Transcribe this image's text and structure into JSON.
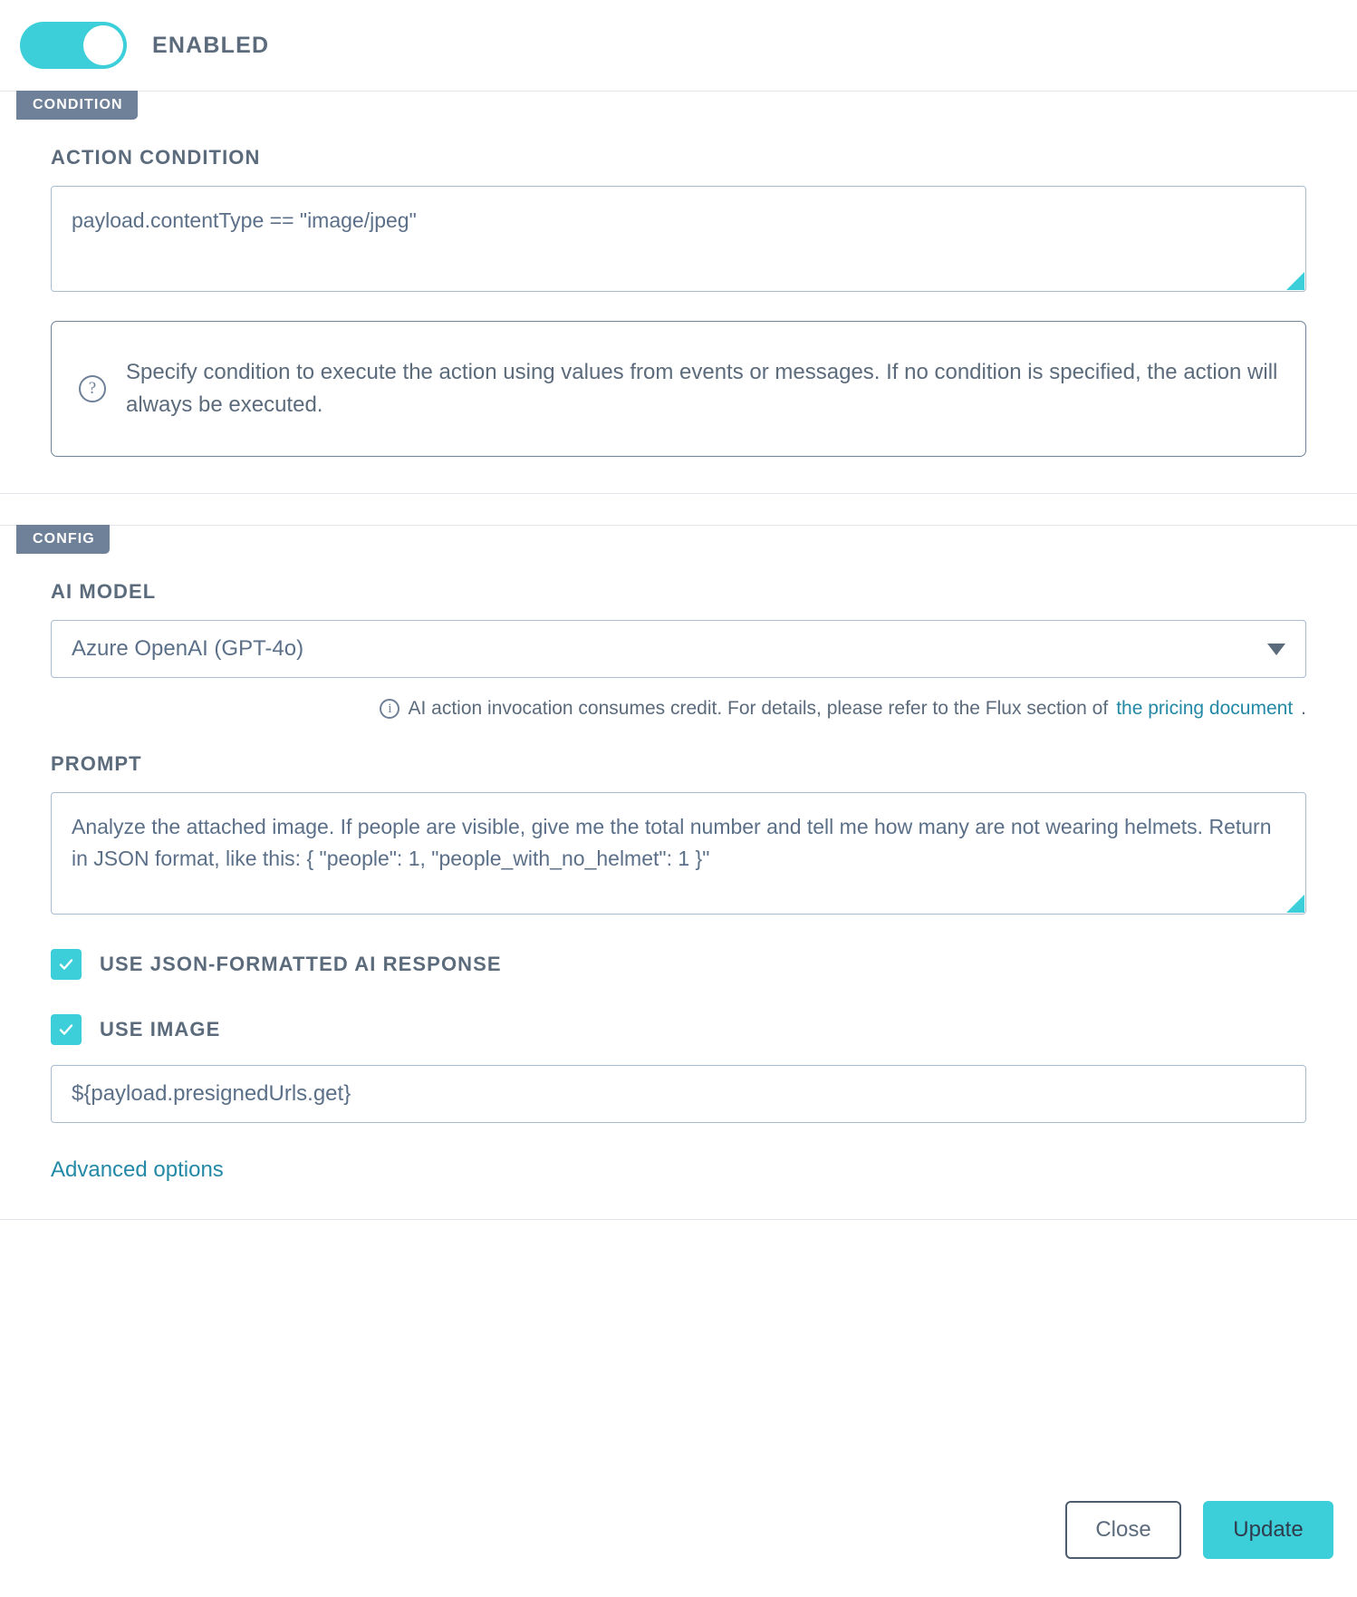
{
  "toggle": {
    "label": "ENABLED",
    "state": "on",
    "color": "#3ccfd9"
  },
  "condition_section": {
    "tag": "CONDITION",
    "field_label": "ACTION CONDITION",
    "condition_value": "payload.contentType == \"image/jpeg\"",
    "hint_icon": "?",
    "hint_text": "Specify condition to execute the action using values from events or messages. If no condition is specified, the action will always be executed."
  },
  "config_section": {
    "tag": "CONFIG",
    "ai_model_label": "AI MODEL",
    "ai_model_value": "Azure OpenAI (GPT-4o)",
    "credit_note_icon": "i",
    "credit_note_text": "AI action invocation consumes credit. For details, please refer to the Flux section of ",
    "credit_note_link": "the pricing document",
    "credit_note_tail": ".",
    "prompt_label": "PROMPT",
    "prompt_value": "Analyze the attached image. If people are visible, give me the total number and tell me how many are not wearing helmets. Return in JSON format, like this: { \"people\": 1, \"people_with_no_helmet\": 1 }\"",
    "checkbox_json_label": "USE JSON-FORMATTED AI RESPONSE",
    "checkbox_json_checked": true,
    "checkbox_image_label": "USE IMAGE",
    "checkbox_image_checked": true,
    "image_url_value": "${payload.presignedUrls.get}",
    "advanced_options_label": "Advanced options"
  },
  "footer": {
    "close_label": "Close",
    "update_label": "Update",
    "update_color": "#3ccfd9"
  }
}
